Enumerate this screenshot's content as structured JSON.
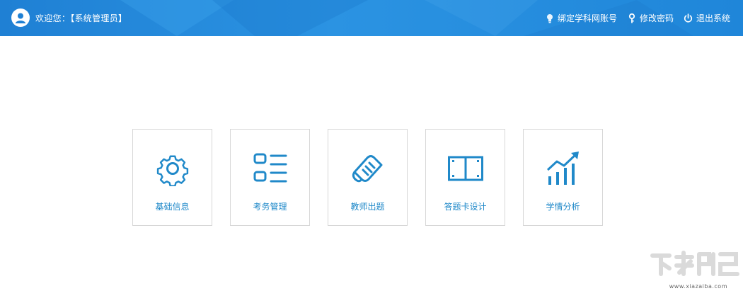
{
  "header": {
    "welcome_text": "欢迎您：【系统管理员】",
    "actions": [
      {
        "label": "绑定学科网账号",
        "icon": "bulb-icon"
      },
      {
        "label": "修改密码",
        "icon": "key-icon"
      },
      {
        "label": "退出系统",
        "icon": "power-icon"
      }
    ]
  },
  "modules": [
    {
      "label": "基础信息",
      "icon": "gear-icon"
    },
    {
      "label": "考务管理",
      "icon": "list-icon"
    },
    {
      "label": "教师出题",
      "icon": "scroll-icon"
    },
    {
      "label": "答题卡设计",
      "icon": "answer-sheet-icon"
    },
    {
      "label": "学情分析",
      "icon": "growth-chart-icon"
    }
  ],
  "watermark": {
    "url": "www.xiazaiba.com"
  },
  "colors": {
    "header_blue": "#1f80d4",
    "accent_blue": "#2089c9",
    "card_border": "#d7d7d7"
  }
}
